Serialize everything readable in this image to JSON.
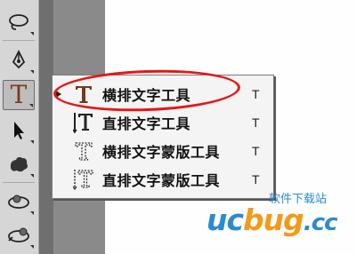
{
  "toolbar": {
    "tools": [
      {
        "icon": "lasso-icon"
      },
      {
        "icon": "pen-icon"
      },
      {
        "icon": "type-icon",
        "letter": "T",
        "active": true
      },
      {
        "icon": "path-selection-icon"
      },
      {
        "icon": "custom-shape-icon"
      },
      {
        "icon": "3d-rotate-icon"
      },
      {
        "icon": "3d-orbit-icon"
      }
    ]
  },
  "flyout": {
    "items": [
      {
        "label": "横排文字工具",
        "shortcut": "T",
        "icon": "horizontal-type-icon",
        "selected": true
      },
      {
        "label": "直排文字工具",
        "shortcut": "T",
        "icon": "vertical-type-icon",
        "selected": false
      },
      {
        "label": "横排文字蒙版工具",
        "shortcut": "T",
        "icon": "horizontal-type-mask-icon",
        "selected": false
      },
      {
        "label": "直排文字蒙版工具",
        "shortcut": "T",
        "icon": "vertical-type-mask-icon",
        "selected": false
      }
    ]
  },
  "watermark": {
    "site_name": "软件下载站",
    "logo_uc": "uc",
    "logo_bug": "bug",
    "logo_cc": ".cc"
  },
  "colors": {
    "highlight": "#e41818",
    "logo_blue": "#2b8bd1",
    "logo_orange": "#f29a1a"
  }
}
